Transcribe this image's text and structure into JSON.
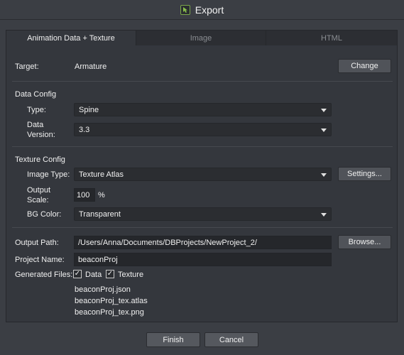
{
  "window": {
    "title": "Export"
  },
  "tabs": [
    {
      "label": "Animation Data + Texture",
      "active": true
    },
    {
      "label": "Image",
      "active": false
    },
    {
      "label": "HTML",
      "active": false
    }
  ],
  "target": {
    "label": "Target:",
    "value": "Armature",
    "change_button": "Change"
  },
  "data_config": {
    "title": "Data Config",
    "type_label": "Type:",
    "type_value": "Spine",
    "version_label_line1": "Data",
    "version_label_line2": "Version:",
    "version_value": "3.3"
  },
  "texture_config": {
    "title": "Texture Config",
    "image_type_label": "Image Type:",
    "image_type_value": "Texture Atlas",
    "settings_button": "Settings...",
    "output_scale_label_line1": "Output",
    "output_scale_label_line2": "Scale:",
    "output_scale_value": "100",
    "output_scale_unit": "%",
    "bg_color_label": "BG Color:",
    "bg_color_value": "Transparent"
  },
  "output": {
    "path_label": "Output Path:",
    "path_value": "/Users/Anna/Documents/DBProjects/NewProject_2/",
    "browse_button": "Browse...",
    "project_name_label": "Project Name:",
    "project_name_value": "beaconProj",
    "generated_files_label": "Generated Files:",
    "data_checkbox_label": "Data",
    "data_checked": true,
    "texture_checkbox_label": "Texture",
    "texture_checked": true,
    "files": [
      "beaconProj.json",
      "beaconProj_tex.atlas",
      "beaconProj_tex.png"
    ]
  },
  "footer": {
    "finish_button": "Finish",
    "cancel_button": "Cancel"
  },
  "colors": {
    "background": "#3b3e44",
    "panel": "#34373d",
    "field": "#2b2d31",
    "button": "#505359",
    "icon_accent": "#7aa64a"
  }
}
